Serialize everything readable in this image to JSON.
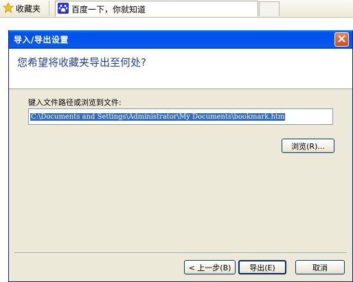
{
  "browser": {
    "favorites_label": "收藏夹",
    "tab_title": "百度一下，你就知道"
  },
  "dialog": {
    "title": "导入/导出设置",
    "question": "您希望将收藏夹导出至何处?",
    "path_label": "键入文件路径或浏览到文件:",
    "path_value": "C:\\Documents and Settings\\Administrator\\My Documents\\bookmark.htm",
    "browse_label": "浏览(R)...",
    "back_label": "< 上一步(B)",
    "export_label": "导出(E)",
    "cancel_label": "取消"
  },
  "colors": {
    "title_bar": "#0054e3",
    "question_text": "#1f3f9a",
    "selection": "#316ac5",
    "close_button": "#d04d1c"
  },
  "icons": {
    "favorites": "star-icon",
    "tab": "baidu-paw-icon",
    "close": "close-icon"
  }
}
